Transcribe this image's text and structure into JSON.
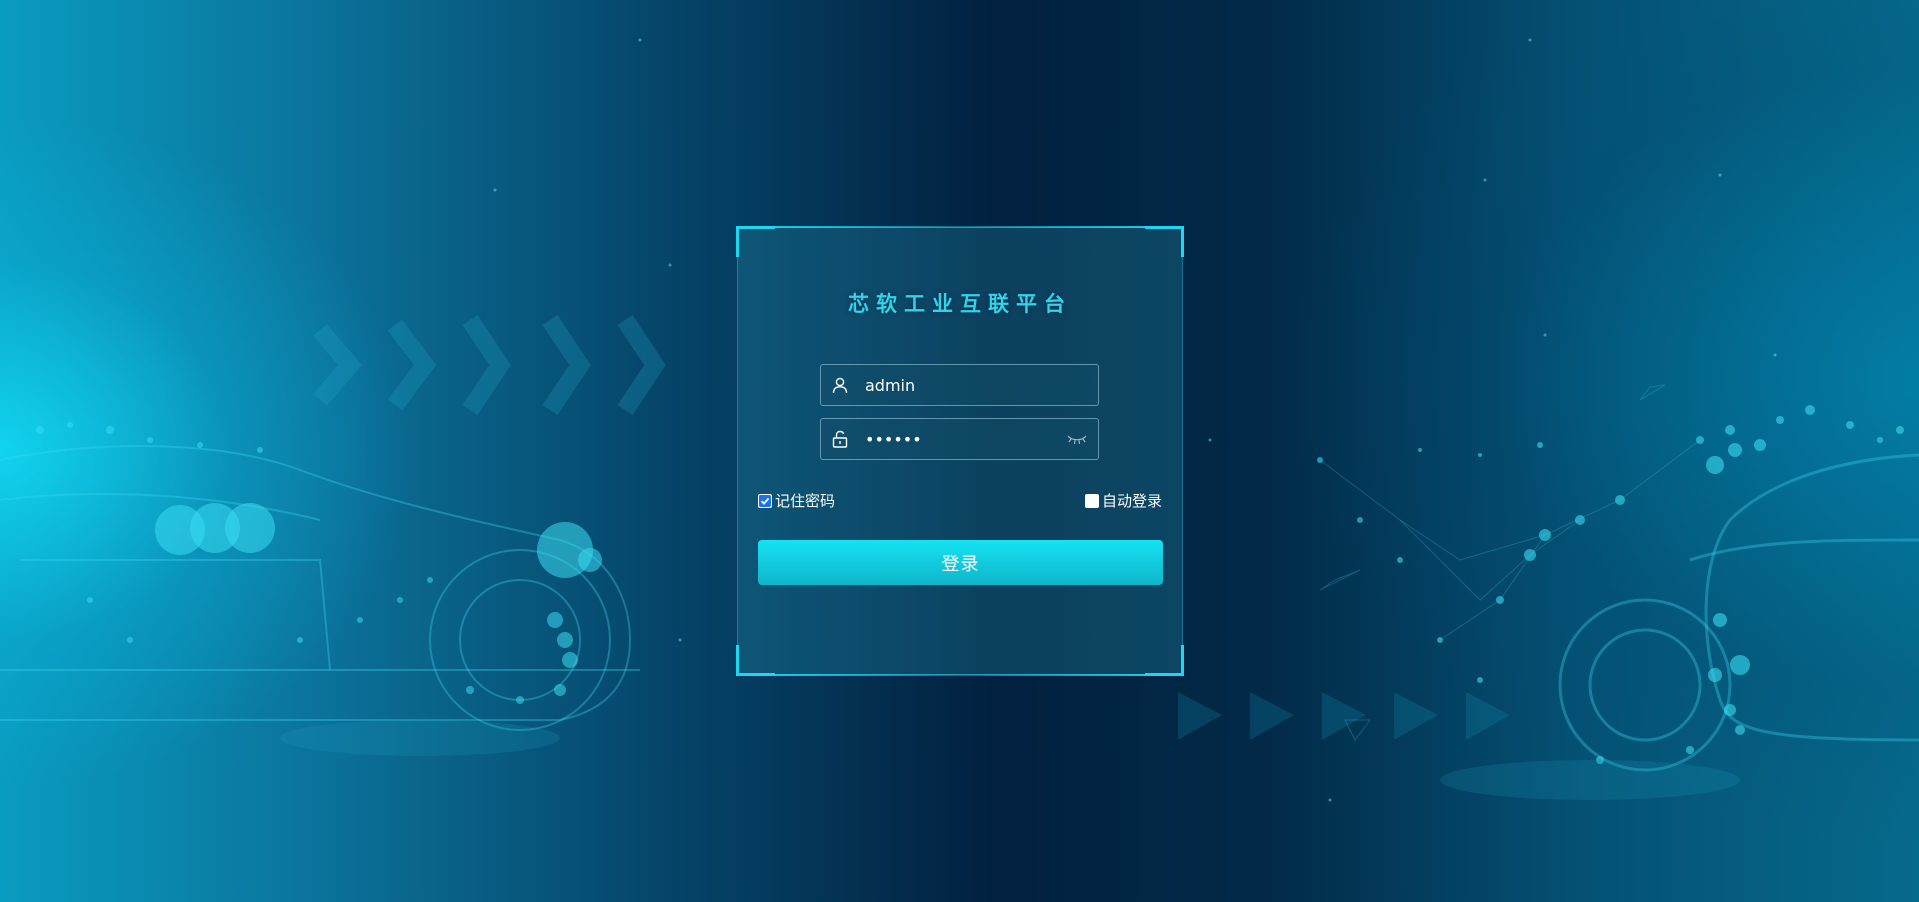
{
  "login": {
    "title": "芯软工业互联平台",
    "username_value": "admin",
    "password_value": "••••••",
    "remember_label": "记住密码",
    "remember_checked": true,
    "auto_login_label": "自动登录",
    "auto_login_checked": false,
    "submit_label": "登录"
  },
  "icons": {
    "username": "user-icon",
    "password": "unlock-icon",
    "toggle_visibility": "eye-closed-icon"
  },
  "colors": {
    "accent": "#1fd6f2",
    "title": "#2ed3ee",
    "button": "#14d2e6"
  }
}
